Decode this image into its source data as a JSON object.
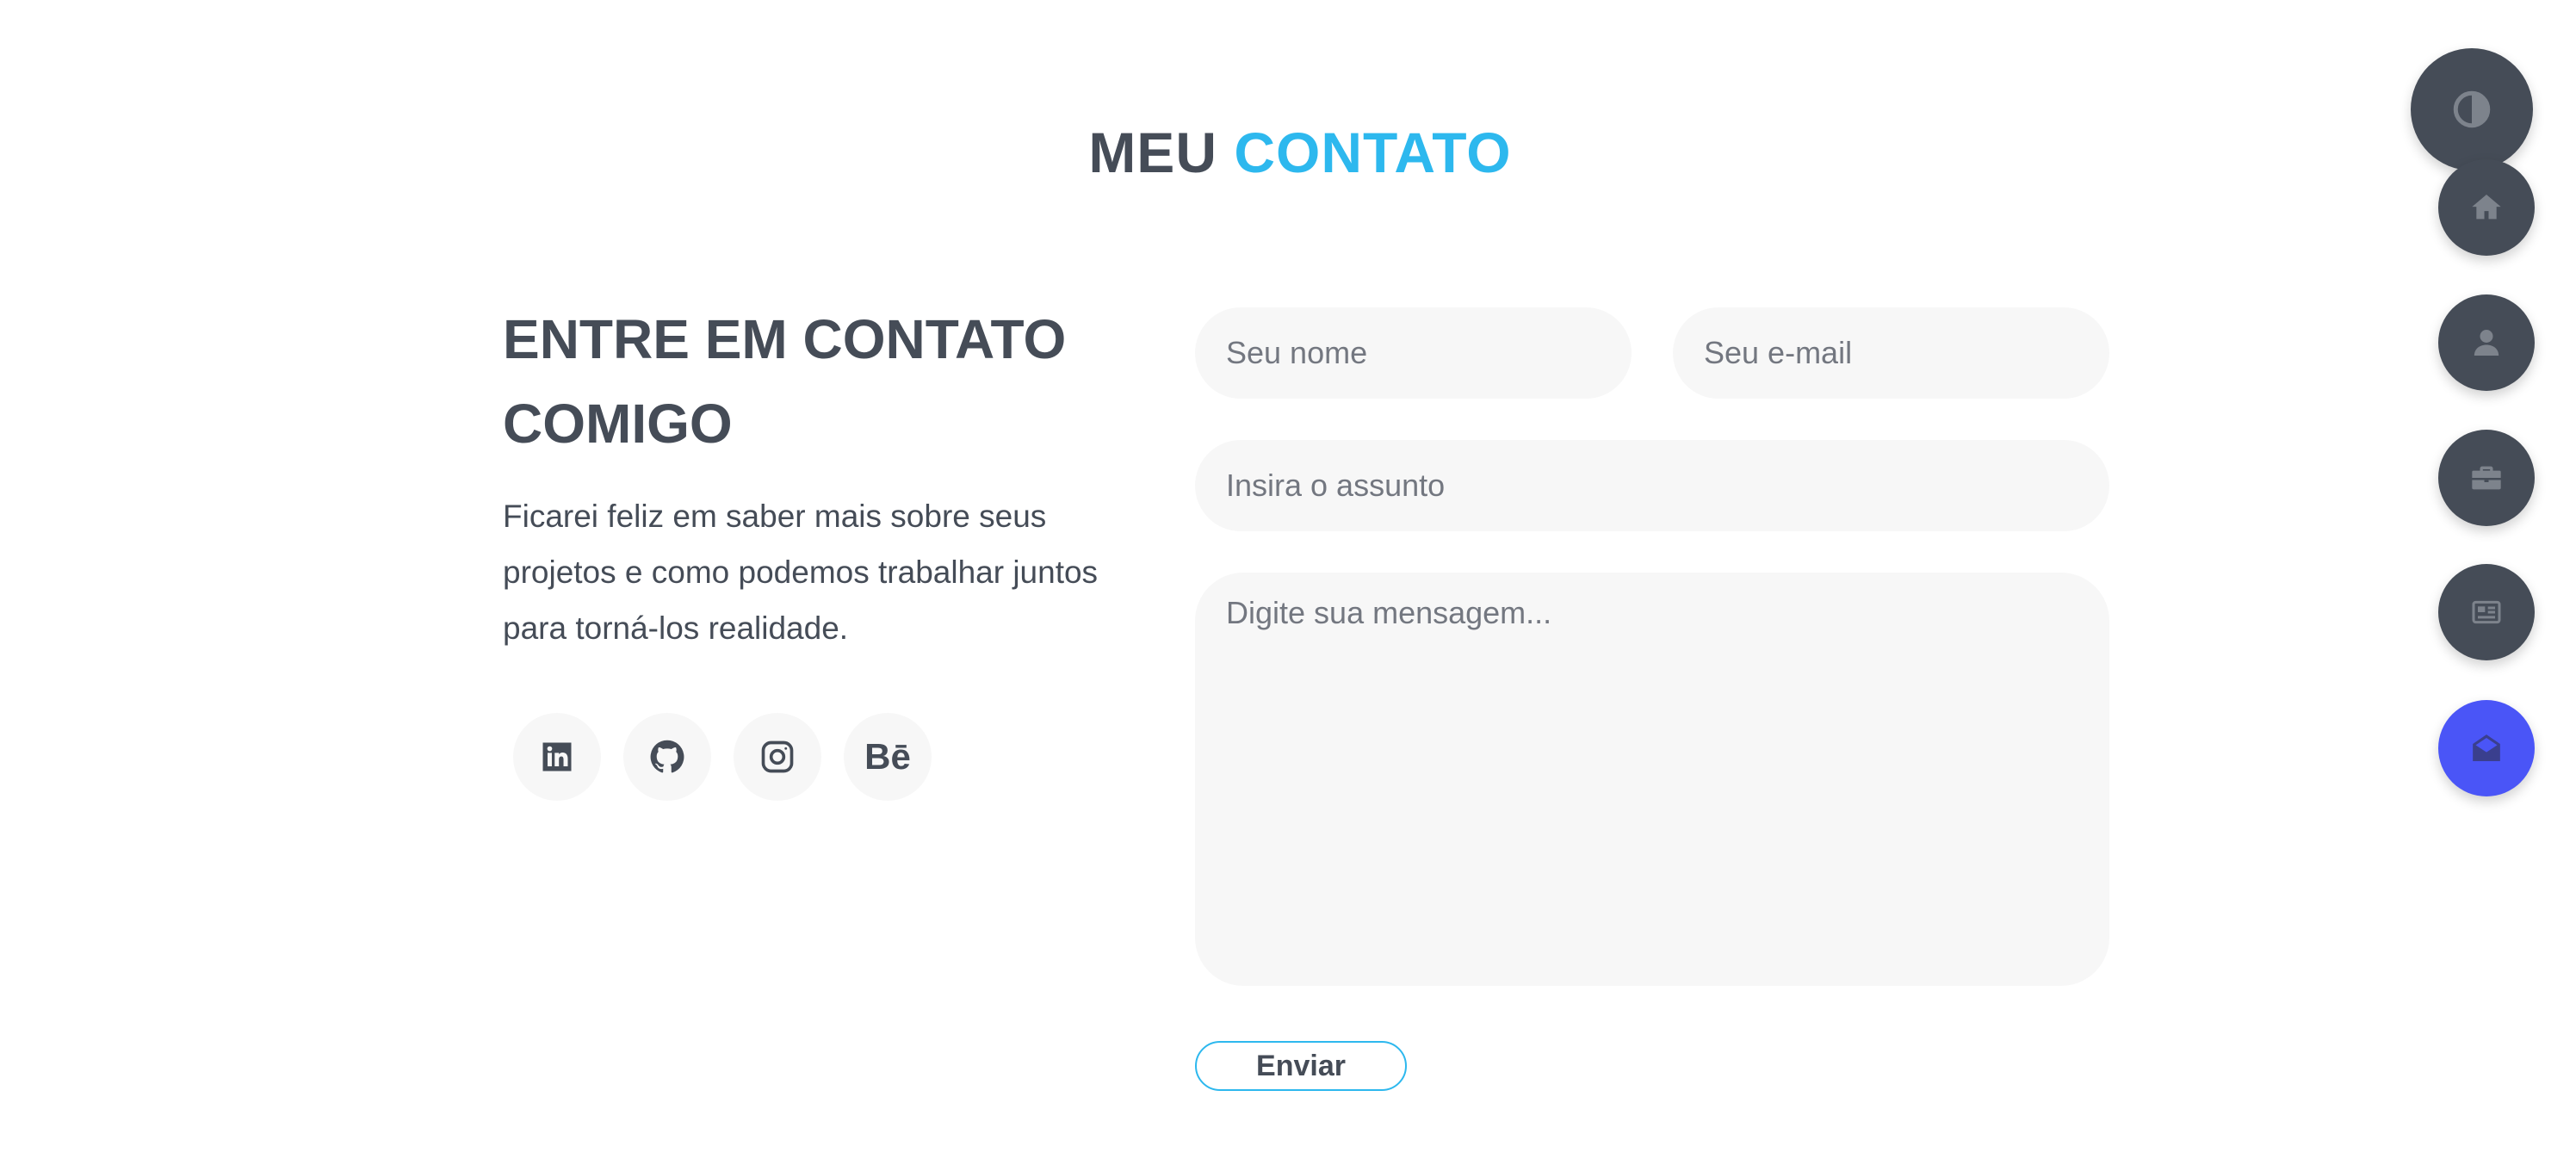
{
  "section_title": {
    "part1": "MEU",
    "part2": "CONTATO"
  },
  "intro": {
    "heading": "ENTRE EM CONTATO COMIGO",
    "text": "Ficarei feliz em saber mais sobre seus projetos e como podemos trabalhar juntos para torná-los realidade."
  },
  "socials": [
    {
      "icon": "linkedin-icon"
    },
    {
      "icon": "github-icon"
    },
    {
      "icon": "instagram-icon"
    },
    {
      "icon": "behance-icon",
      "text": "Bē"
    }
  ],
  "form": {
    "name_placeholder": "Seu nome",
    "email_placeholder": "Seu e-mail",
    "subject_placeholder": "Insira o assunto",
    "message_placeholder": "Digite sua mensagem...",
    "submit_label": "Enviar"
  },
  "side_nav": [
    {
      "icon": "theme-toggle-icon"
    },
    {
      "icon": "home-icon"
    },
    {
      "icon": "user-icon"
    },
    {
      "icon": "briefcase-icon"
    },
    {
      "icon": "newspaper-icon"
    },
    {
      "icon": "envelope-open-icon",
      "active": true
    }
  ],
  "colors": {
    "accent": "#2db8ee",
    "text": "#454c57",
    "nav_bg": "#454c57",
    "nav_active": "#4a55f7",
    "field_bg": "#f7f7f7"
  }
}
